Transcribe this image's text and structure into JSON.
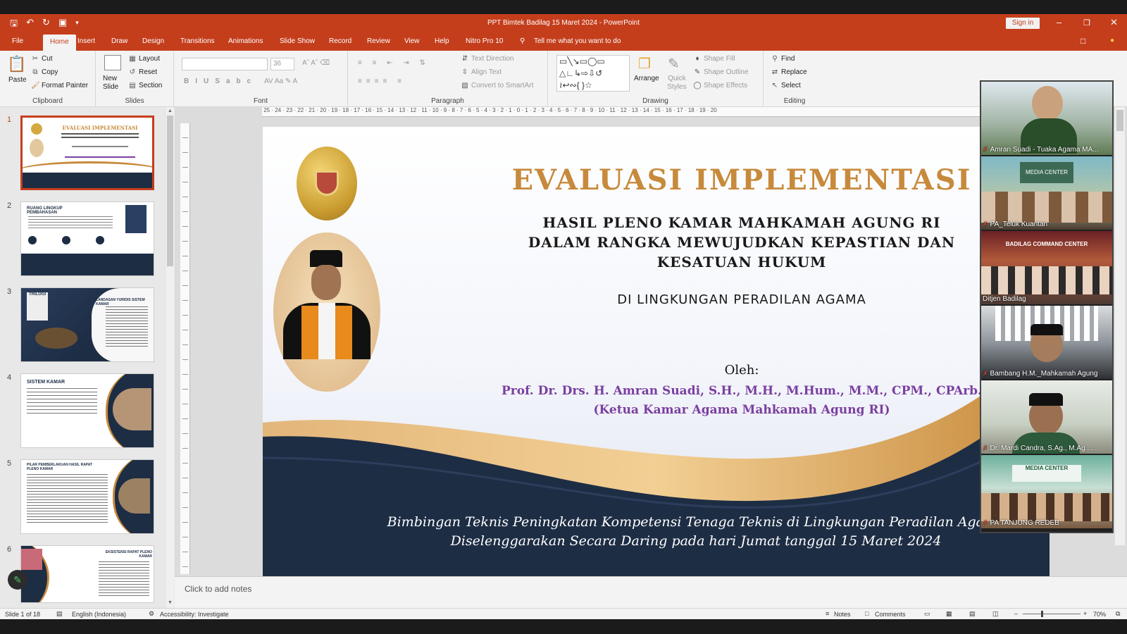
{
  "window": {
    "title": "PPT Bimtek Badilag 15 Maret 2024 - PowerPoint",
    "signin_label": "Sign in"
  },
  "tabs": [
    "File",
    "Home",
    "Insert",
    "Draw",
    "Design",
    "Transitions",
    "Animations",
    "Slide Show",
    "Record",
    "Review",
    "View",
    "Help",
    "Nitro Pro 10"
  ],
  "active_tab": "Home",
  "tell_me": "Tell me what you want to do",
  "ribbon": {
    "clipboard": {
      "paste": "Paste",
      "cut": "Cut",
      "copy": "Copy",
      "format_painter": "Format Painter",
      "label": "Clipboard"
    },
    "slides": {
      "new_slide": "New Slide",
      "layout": "Layout",
      "reset": "Reset",
      "section": "Section",
      "label": "Slides"
    },
    "font": {
      "size": "36",
      "label": "Font"
    },
    "paragraph": {
      "text_direction": "Text Direction",
      "align_text": "Align Text",
      "convert": "Convert to SmartArt",
      "label": "Paragraph"
    },
    "drawing": {
      "arrange": "Arrange",
      "quick_styles": "Quick Styles",
      "shape_fill": "Shape Fill",
      "shape_outline": "Shape Outline",
      "shape_effects": "Shape Effects",
      "label": "Drawing"
    },
    "editing": {
      "find": "Find",
      "replace": "Replace",
      "select": "Select",
      "label": "Editing"
    }
  },
  "thumbnails": [
    {
      "num": "1",
      "title": "EVALUASI IMPLEMENTASI"
    },
    {
      "num": "2",
      "title": "RUANG LINGKUP PEMBAHASAN"
    },
    {
      "num": "3",
      "title": "LANDASAN YURIDIS SISTEM KAMAR"
    },
    {
      "num": "4",
      "title": "SISTEM KAMAR"
    },
    {
      "num": "5",
      "title": "PILAR PEMBERLAKUAN HASIL RAPAT PLENO KAMAR"
    },
    {
      "num": "6",
      "title": "EKSISTENSI RAPAT PLENO KAMAR"
    }
  ],
  "slide": {
    "title": "EVALUASI IMPLEMENTASI",
    "subtitle_lines": [
      "HASIL PLENO KAMAR MAHKAMAH AGUNG RI",
      "DALAM RANGKA MEWUJUDKAN KEPASTIAN DAN",
      "KESATUAN HUKUM"
    ],
    "scope": "DI LINGKUNGAN PERADILAN AGAMA",
    "oleh": "Oleh:",
    "author": "Prof. Dr. Drs. H. Amran Suadi, S.H., M.H., M.Hum., M.M., CPM., CPArb.",
    "author_role": "(Ketua Kamar Agama Mahkamah Agung RI)",
    "footer_line1": "Bimbingan Teknis Peningkatan Kompetensi Tenaga Teknis di Lingkungan Peradilan Agama",
    "footer_line2": "Diselenggarakan Secara Daring pada hari Jumat tanggal 15 Maret 2024"
  },
  "participants": [
    {
      "name": "Amran Suadi - Tuaka Agama MA..."
    },
    {
      "name": "PA_Teluk Kuantan"
    },
    {
      "name": "Ditjen Badilag"
    },
    {
      "name": "Bambang H.M._Mahkamah Agung"
    },
    {
      "name": "Dr. Mardi Candra, S.Ag., M.Ag., ..."
    },
    {
      "name": "PA TANJUNG REDEB"
    }
  ],
  "notes_placeholder": "Click to add notes",
  "status": {
    "slide": "Slide 1 of 18",
    "language": "English (Indonesia)",
    "accessibility": "Accessibility: Investigate",
    "notes": "Notes",
    "comments": "Comments",
    "zoom": "70%"
  },
  "colors": {
    "accent": "#c43e1c",
    "gold": "#c78a3c",
    "navy": "#1d2d44",
    "purple": "#7b3fa0"
  }
}
